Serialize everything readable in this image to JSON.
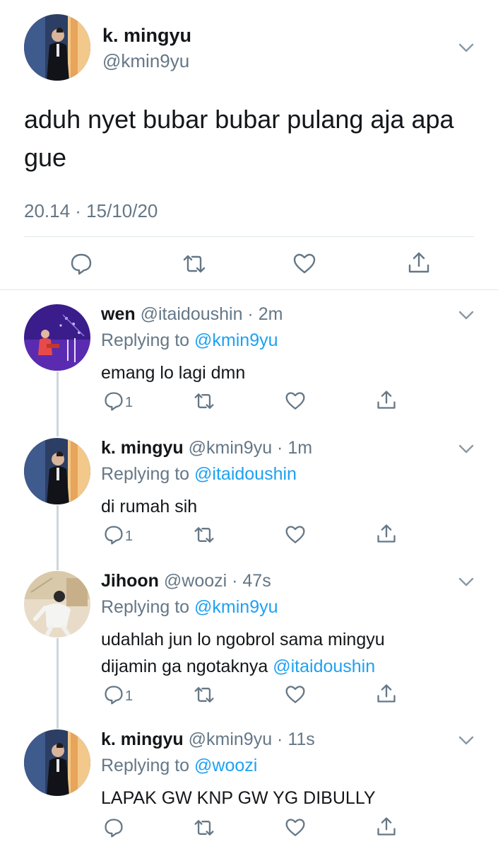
{
  "main_tweet": {
    "name": "k. mingyu",
    "handle": "@kmin9yu",
    "text": "aduh nyet bubar bubar pulang aja apa gue",
    "timestamp": "20.14 · 15/10/20",
    "actions": [
      "reply-icon",
      "retweet-icon",
      "like-icon",
      "share-icon"
    ]
  },
  "replies": [
    {
      "name": "wen",
      "meta": "@itaidoushin · 2m",
      "replying_label": "Replying to",
      "replying_to": "@kmin9yu",
      "text": "emang lo lagi dmn",
      "text_mention": "",
      "reply_count": "1"
    },
    {
      "name": "k. mingyu",
      "meta": "@kmin9yu · 1m",
      "replying_label": "Replying to",
      "replying_to": "@itaidoushin",
      "text": "di rumah sih",
      "text_mention": "",
      "reply_count": "1"
    },
    {
      "name": "Jihoon",
      "meta": "@woozi · 47s",
      "replying_label": "Replying to",
      "replying_to": "@kmin9yu",
      "text": "udahlah jun lo ngobrol sama mingyu dijamin ga ngotaknya",
      "text_mention": "@itaidoushin",
      "reply_count": "1"
    },
    {
      "name": "k. mingyu",
      "meta": "@kmin9yu · 11s",
      "replying_label": "Replying to",
      "replying_to": "@woozi",
      "text": "LAPAK GW KNP GW YG DIBULLY",
      "text_mention": "",
      "reply_count": ""
    }
  ],
  "colors": {
    "link": "#1da1f2",
    "muted": "#657786",
    "thread_line": "#ccd6dd",
    "divider": "#e1e8ed"
  }
}
